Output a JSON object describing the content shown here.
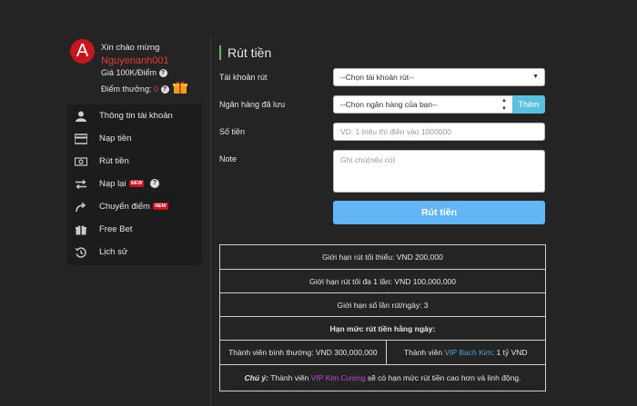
{
  "profile": {
    "avatar_letter": "A",
    "greeting": "Xin chào mừng",
    "username": "Nguyenanh001",
    "price": "Giá 100K/Điểm",
    "points_label": "Điểm thưởng:",
    "points_value": "0",
    "help": "?"
  },
  "menu": [
    {
      "label": "Thông tin tài khoản",
      "icon": "user-icon"
    },
    {
      "label": "Nạp tiền",
      "icon": "credit-card-icon"
    },
    {
      "label": "Rút tiền",
      "icon": "money-icon"
    },
    {
      "label": "Nạp lại",
      "icon": "exchange-icon",
      "badge": "NEW",
      "help": "?"
    },
    {
      "label": "Chuyển điểm",
      "icon": "share-icon",
      "badge": "NEW"
    },
    {
      "label": "Free Bet",
      "icon": "gift-icon"
    },
    {
      "label": "Lịch sử",
      "icon": "history-icon"
    }
  ],
  "page": {
    "title": "Rút tiền"
  },
  "form": {
    "account_label": "Tài khoản rút",
    "account_value": "--Chọn tài khoản rút--",
    "bank_label": "Ngân hàng đã lưu",
    "bank_value": "--Chọn ngân hàng của bạn--",
    "add_button": "Thêm",
    "amount_label": "Số tiền",
    "amount_placeholder": "VD: 1 triệu thì điền vào 1000000",
    "note_label": "Note",
    "note_placeholder": "Ghi chú(nếu có)",
    "submit": "Rút tiền"
  },
  "limits": {
    "min": "Giới hạn rút tối thiểu: VND 200,000",
    "max": "Giới hạn rút tối đa 1 lần: VND 100,000,000",
    "per_day": "Giới hạn số lần rút/ngày: 3",
    "daily_header": "Hạn mức rút tiền hằng ngày:",
    "normal": "Thành viên bình thường: VND 300,000,000",
    "vip_prefix": "Thành viên",
    "vip_name": "VIP Bạch Kim",
    "vip_suffix": ": 1 tỷ VND",
    "note_prefix": "Chú ý:",
    "note_mid": "Thành viên",
    "note_vip": "VIP Kim Cương",
    "note_suffix": "sẽ có hạn mức rút tiền cao hơn và linh động."
  },
  "colors": {
    "accent_blue": "#64b5f6",
    "accent_red": "#e23b3b",
    "title_bar": "#5cb85c",
    "vip_blue": "#4aa3df",
    "vip_purple": "#b84bd6"
  }
}
